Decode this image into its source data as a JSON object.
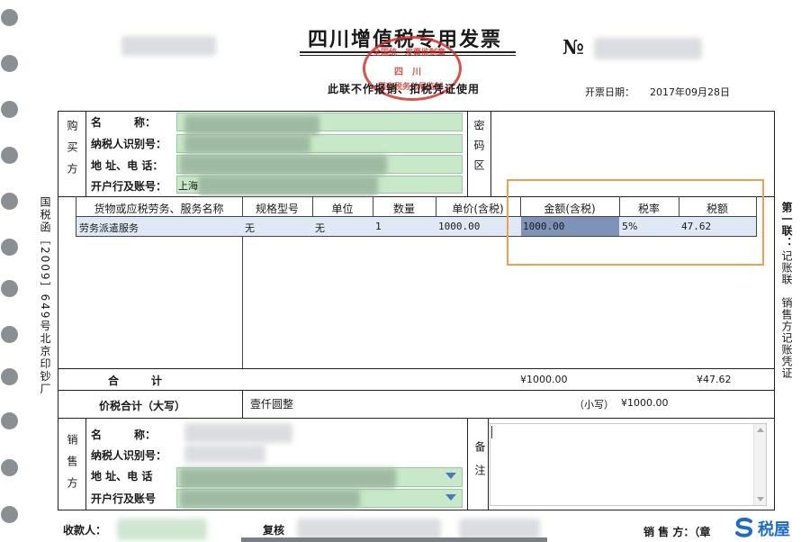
{
  "invoice": {
    "title": "四川增值税专用发票",
    "subtitle": "此联不作报销、扣税凭证使用",
    "no_label": "№",
    "issue_date_label": "开票日期：",
    "issue_date": "2017年09月28日"
  },
  "stamp": {
    "text_top": "全国统一发票监制章",
    "text_middle": "四　川",
    "text_bottom": "国家税务总局监制"
  },
  "buyer": {
    "section_label": "购买方",
    "name_label": "名　　　称：",
    "tax_id_label": "纳税人识别号：",
    "address_label": "地 址、电 话：",
    "bank_label": "开户行及账号：",
    "bank_prefix": "上海"
  },
  "cipher": {
    "label": "密码区"
  },
  "items": {
    "headers": [
      "货物或应税劳务、服务名称",
      "规格型号",
      "单位",
      "数量",
      "单价(含税)",
      "金额(含税)",
      "税率",
      "税额"
    ],
    "rows": [
      [
        "劳务派遣服务",
        "无",
        "无",
        "1",
        "1000.00",
        "1000.00",
        "5%",
        "47.62"
      ]
    ]
  },
  "totals": {
    "label": "合　　　计",
    "amount": "¥1000.00",
    "tax": "¥47.62"
  },
  "grand_total": {
    "label": "价税合计（大写）",
    "in_words": "壹仟圆整",
    "small_label": "（小写）",
    "small_value": "¥1000.00"
  },
  "seller": {
    "section_label": "销售方",
    "name_label": "名　　　称：",
    "tax_id_label": "纳税人识别号：",
    "address_label": "地 址、电 话",
    "bank_label": "开户行及账号"
  },
  "remarks": {
    "label": "备注"
  },
  "footer": {
    "payee_label": "收款人：",
    "reviewer_label": "复核",
    "seller_label": "销 售 方：（章"
  },
  "side_left": "国税函［2009］649号北京印钞厂",
  "side_right_main": "第一联：",
  "side_right_sub": "记账联　销售方记账凭证",
  "brand": {
    "name": "税屋"
  },
  "colors": {
    "highlight_box": "#f0a050",
    "selected_cell": "#7f93b8",
    "field_green": "#c7e9c9",
    "stamp_red": "#d6332c"
  }
}
